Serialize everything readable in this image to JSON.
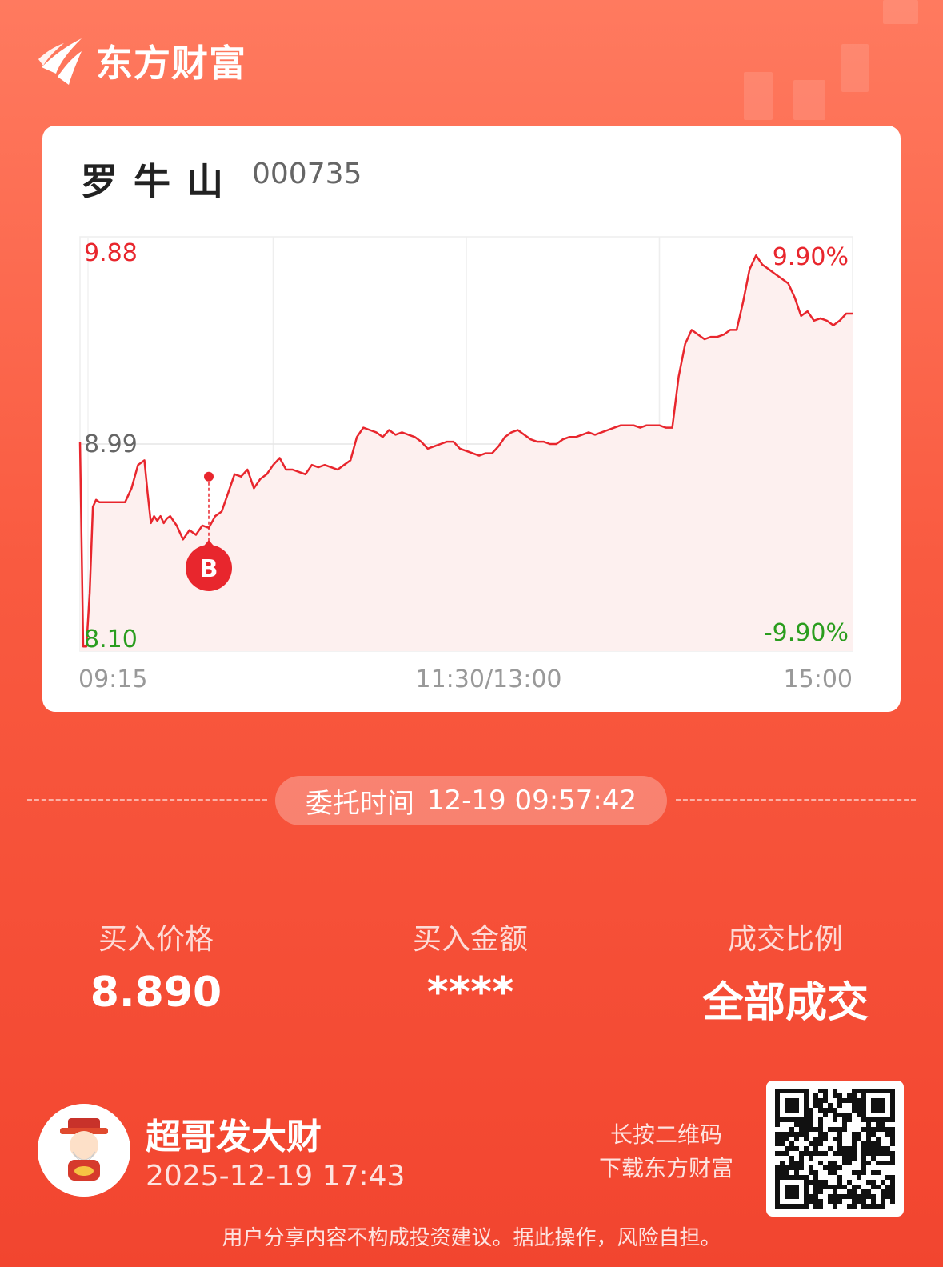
{
  "brand": {
    "name": "东方财富"
  },
  "stock": {
    "name": "罗牛山",
    "code": "000735"
  },
  "chart_data": {
    "type": "line",
    "x_labels": [
      "09:15",
      "11:30/13:00",
      "15:00"
    ],
    "y_left_labels": {
      "max": "9.88",
      "mid": "8.99",
      "min": "8.10"
    },
    "y_right_labels": {
      "max": "9.90%",
      "min": "-9.90%"
    },
    "ylim": [
      8.1,
      9.88
    ],
    "prev_close": 8.99,
    "x_range": [
      0,
      240
    ],
    "series": [
      {
        "x": [
          0,
          1,
          2,
          3,
          4,
          5,
          6,
          7,
          8,
          10,
          12,
          14,
          16,
          18,
          20,
          21,
          22,
          23,
          24,
          25,
          26,
          27,
          28,
          29,
          30,
          32,
          34,
          36,
          38,
          40,
          42,
          44,
          46,
          48,
          50,
          52,
          54,
          56,
          58,
          60,
          62,
          64,
          66,
          68,
          70,
          72,
          74,
          76,
          78,
          80,
          82,
          84,
          86,
          88,
          90,
          92,
          94,
          96,
          98,
          100,
          102,
          104,
          106,
          108,
          110,
          112,
          114,
          116,
          118,
          120,
          122,
          124,
          126,
          128,
          130,
          132,
          134,
          136,
          138,
          140,
          142,
          144,
          146,
          148,
          150,
          152,
          154,
          156,
          158,
          160,
          162,
          164,
          166,
          168,
          170,
          172,
          174,
          176,
          178,
          180,
          182,
          184,
          186,
          188,
          190,
          192,
          194,
          196,
          198,
          200,
          202,
          204,
          206,
          208,
          210,
          212,
          214,
          216,
          218,
          220,
          222,
          224,
          226,
          228,
          230,
          232,
          234,
          236,
          238,
          240
        ],
        "values": [
          9.0,
          8.12,
          8.12,
          8.35,
          8.72,
          8.75,
          8.74,
          8.74,
          8.74,
          8.74,
          8.74,
          8.74,
          8.8,
          8.9,
          8.92,
          8.78,
          8.65,
          8.68,
          8.66,
          8.68,
          8.65,
          8.67,
          8.68,
          8.66,
          8.64,
          8.58,
          8.62,
          8.6,
          8.64,
          8.63,
          8.68,
          8.7,
          8.78,
          8.86,
          8.85,
          8.88,
          8.8,
          8.84,
          8.86,
          8.9,
          8.93,
          8.88,
          8.88,
          8.87,
          8.86,
          8.9,
          8.89,
          8.9,
          8.89,
          8.88,
          8.9,
          8.92,
          9.02,
          9.06,
          9.05,
          9.04,
          9.02,
          9.05,
          9.03,
          9.04,
          9.03,
          9.02,
          9.0,
          8.97,
          8.98,
          8.99,
          9.0,
          9.0,
          8.97,
          8.96,
          8.95,
          8.94,
          8.95,
          8.95,
          8.98,
          9.02,
          9.04,
          9.05,
          9.03,
          9.01,
          9.0,
          9.0,
          8.99,
          8.99,
          9.01,
          9.02,
          9.02,
          9.03,
          9.04,
          9.03,
          9.04,
          9.05,
          9.06,
          9.07,
          9.07,
          9.07,
          9.06,
          9.07,
          9.07,
          9.07,
          9.06,
          9.06,
          9.28,
          9.42,
          9.48,
          9.46,
          9.44,
          9.45,
          9.45,
          9.46,
          9.48,
          9.48,
          9.6,
          9.74,
          9.8,
          9.76,
          9.74,
          9.72,
          9.7,
          9.68,
          9.62,
          9.54,
          9.56,
          9.52,
          9.53,
          9.52,
          9.5,
          9.52,
          9.55,
          9.55
        ]
      }
    ],
    "trade_marker": {
      "label": "B",
      "x": 40,
      "value": 8.85
    }
  },
  "order": {
    "label": "委托时间",
    "value": "12-19 09:57:42"
  },
  "stats": [
    {
      "label": "买入价格",
      "value": "8.890"
    },
    {
      "label": "买入金额",
      "value": "****"
    },
    {
      "label": "成交比例",
      "value": "全部成交"
    }
  ],
  "user": {
    "name": "超哥发大财",
    "timestamp": "2025-12-19 17:43"
  },
  "qr": {
    "hint_line1": "长按二维码",
    "hint_line2": "下载东方财富"
  },
  "disclaimer": "用户分享内容不构成投资建议。据此操作，风险自担。",
  "colors": {
    "up": "#e8262d",
    "down": "#2a9d1e",
    "neutral": "#666666",
    "background": "#f95a40"
  }
}
